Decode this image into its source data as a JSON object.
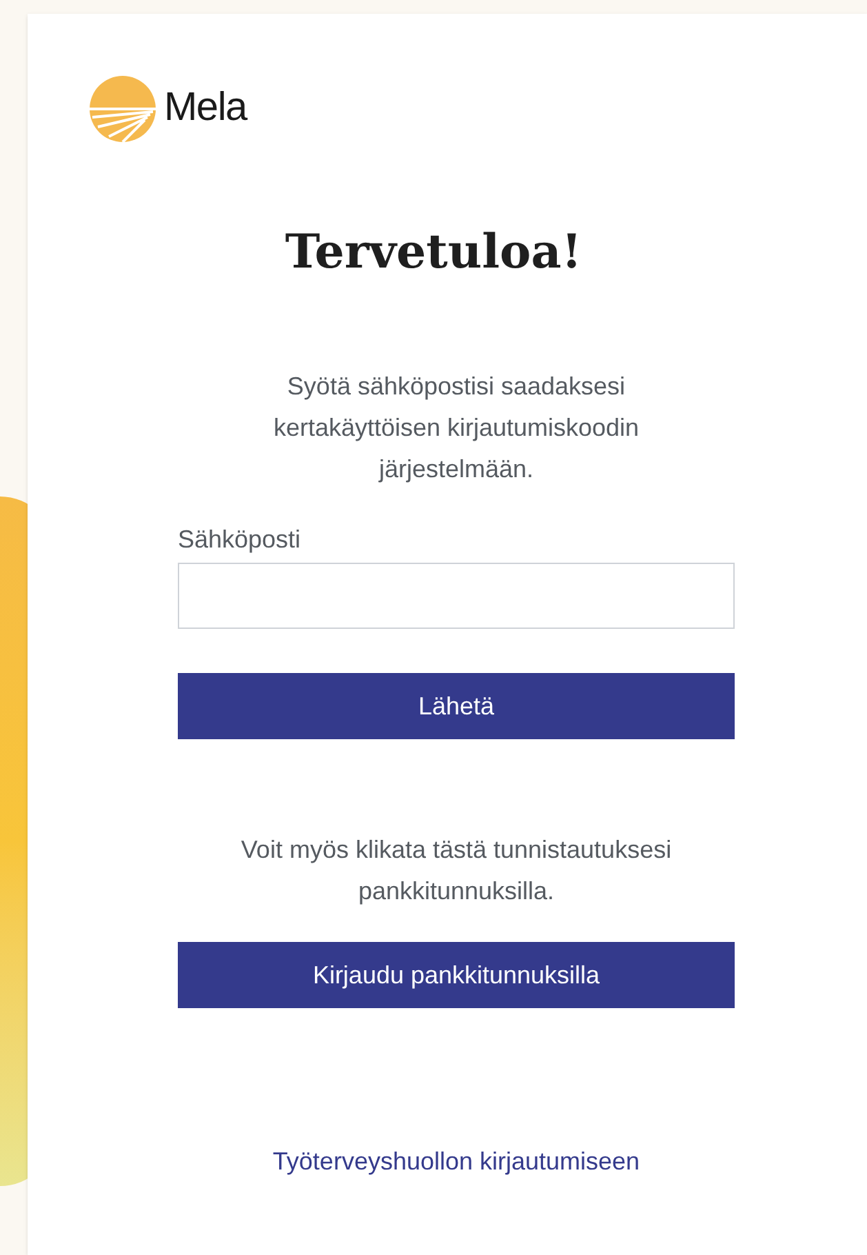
{
  "logo": {
    "text": "Mela"
  },
  "heading": "Tervetuloa!",
  "intro": "Syötä sähköpostisi saadaksesi kertakäyttöisen kirjautumiskoodin järjestelmään.",
  "email_field": {
    "label": "Sähköposti"
  },
  "submit_button": "Lähetä",
  "bank_note": "Voit myös klikata tästä tunnistautuksesi pankkitunnuksilla.",
  "bank_button": "Kirjaudu pankkitunnuksilla",
  "footer_link": "Työterveyshuollon kirjautumiseen"
}
